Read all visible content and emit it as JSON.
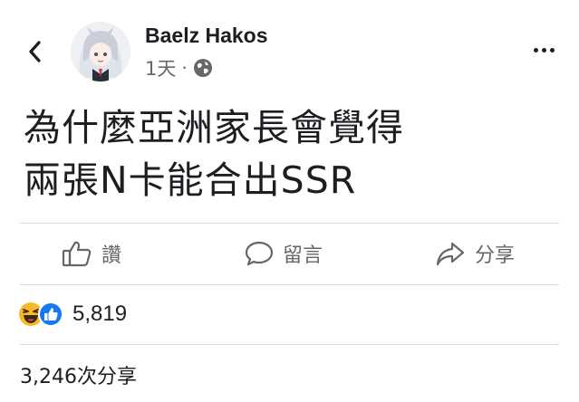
{
  "post": {
    "author": "Baelz Hakos",
    "time": "1天",
    "separator": "·",
    "text_line1": "為什麼亞洲家長會覺得",
    "text_line2": "兩張N卡能合出SSR"
  },
  "icons": {
    "back": "chevron-left-icon",
    "more": "more-dots-icon",
    "privacy": "globe-icon",
    "like": "thumbs-up-icon",
    "comment": "speech-bubble-icon",
    "share": "share-arrow-icon",
    "haha": "laughing-emoji-icon",
    "like_reaction": "blue-like-badge-icon"
  },
  "actions": {
    "like_label": "讚",
    "comment_label": "留言",
    "share_label": "分享"
  },
  "stats": {
    "reaction_count": "5,819",
    "share_count": "3,246次分享"
  },
  "colors": {
    "like_blue": "#1877f2",
    "haha_yellow": "#f7b928",
    "secondary_text": "#65676b"
  }
}
